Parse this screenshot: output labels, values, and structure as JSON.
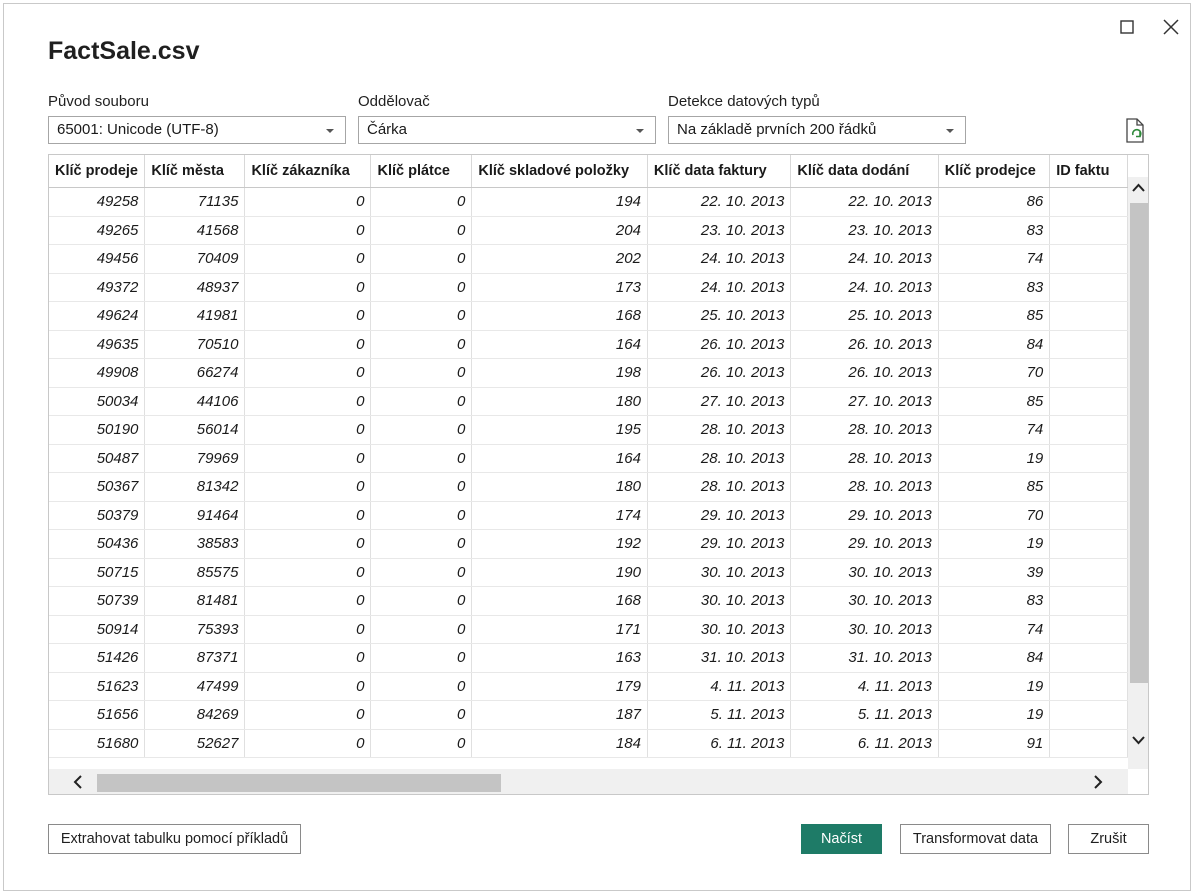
{
  "window": {
    "title": "FactSale.csv",
    "maximize_icon": "maximize-icon",
    "close_icon": "close-icon"
  },
  "fields": {
    "origin": {
      "label": "Původ souboru",
      "value": "65001: Unicode (UTF-8)"
    },
    "delimiter": {
      "label": "Oddělovač",
      "value": "Čárka"
    },
    "type_detection": {
      "label": "Detekce datových typů",
      "value": "Na základě prvních 200 řádků"
    }
  },
  "refresh_icon": "refresh-file-icon",
  "table": {
    "columns": [
      "Klíč prodeje",
      "Klíč města",
      "Klíč zákazníka",
      "Klíč plátce",
      "Klíč skladové položky",
      "Klíč data faktury",
      "Klíč data dodání",
      "Klíč prodejce",
      "ID faktu"
    ],
    "rows": [
      [
        "49258",
        "71135",
        "0",
        "0",
        "194",
        "22. 10. 2013",
        "22. 10. 2013",
        "86",
        ""
      ],
      [
        "49265",
        "41568",
        "0",
        "0",
        "204",
        "23. 10. 2013",
        "23. 10. 2013",
        "83",
        ""
      ],
      [
        "49456",
        "70409",
        "0",
        "0",
        "202",
        "24. 10. 2013",
        "24. 10. 2013",
        "74",
        ""
      ],
      [
        "49372",
        "48937",
        "0",
        "0",
        "173",
        "24. 10. 2013",
        "24. 10. 2013",
        "83",
        ""
      ],
      [
        "49624",
        "41981",
        "0",
        "0",
        "168",
        "25. 10. 2013",
        "25. 10. 2013",
        "85",
        ""
      ],
      [
        "49635",
        "70510",
        "0",
        "0",
        "164",
        "26. 10. 2013",
        "26. 10. 2013",
        "84",
        ""
      ],
      [
        "49908",
        "66274",
        "0",
        "0",
        "198",
        "26. 10. 2013",
        "26. 10. 2013",
        "70",
        ""
      ],
      [
        "50034",
        "44106",
        "0",
        "0",
        "180",
        "27. 10. 2013",
        "27. 10. 2013",
        "85",
        ""
      ],
      [
        "50190",
        "56014",
        "0",
        "0",
        "195",
        "28. 10. 2013",
        "28. 10. 2013",
        "74",
        ""
      ],
      [
        "50487",
        "79969",
        "0",
        "0",
        "164",
        "28. 10. 2013",
        "28. 10. 2013",
        "19",
        ""
      ],
      [
        "50367",
        "81342",
        "0",
        "0",
        "180",
        "28. 10. 2013",
        "28. 10. 2013",
        "85",
        ""
      ],
      [
        "50379",
        "91464",
        "0",
        "0",
        "174",
        "29. 10. 2013",
        "29. 10. 2013",
        "70",
        ""
      ],
      [
        "50436",
        "38583",
        "0",
        "0",
        "192",
        "29. 10. 2013",
        "29. 10. 2013",
        "19",
        ""
      ],
      [
        "50715",
        "85575",
        "0",
        "0",
        "190",
        "30. 10. 2013",
        "30. 10. 2013",
        "39",
        ""
      ],
      [
        "50739",
        "81481",
        "0",
        "0",
        "168",
        "30. 10. 2013",
        "30. 10. 2013",
        "83",
        ""
      ],
      [
        "50914",
        "75393",
        "0",
        "0",
        "171",
        "30. 10. 2013",
        "30. 10. 2013",
        "74",
        ""
      ],
      [
        "51426",
        "87371",
        "0",
        "0",
        "163",
        "31. 10. 2013",
        "31. 10. 2013",
        "84",
        ""
      ],
      [
        "51623",
        "47499",
        "0",
        "0",
        "179",
        "4. 11. 2013",
        "4. 11. 2013",
        "19",
        ""
      ],
      [
        "51656",
        "84269",
        "0",
        "0",
        "187",
        "5. 11. 2013",
        "5. 11. 2013",
        "19",
        ""
      ],
      [
        "51680",
        "52627",
        "0",
        "0",
        "184",
        "6. 11. 2013",
        "6. 11. 2013",
        "91",
        ""
      ]
    ]
  },
  "buttons": {
    "extract": "Extrahovat tabulku pomocí příkladů",
    "load": "Načíst",
    "transform": "Transformovat data",
    "cancel": "Zrušit"
  },
  "colors": {
    "primary": "#1e7b67"
  }
}
